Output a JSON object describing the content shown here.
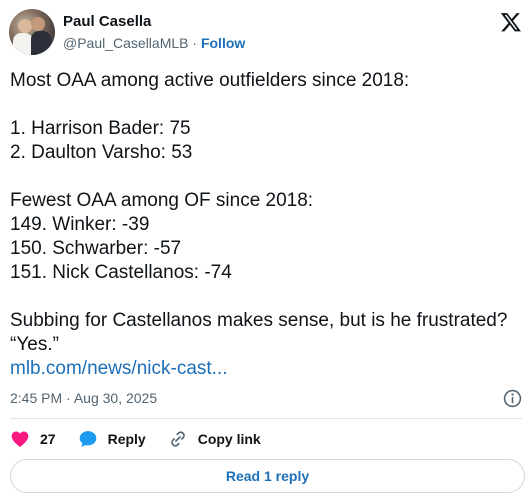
{
  "author": {
    "name": "Paul Casella",
    "handle": "@Paul_CasellaMLB",
    "separator": "·",
    "follow_label": "Follow",
    "avatar_icon": "profile-photo"
  },
  "tweet": {
    "lines": [
      "Most OAA among active outfielders since 2018:",
      "",
      "1. Harrison Bader: 75",
      "2. Daulton Varsho: 53",
      "",
      "Fewest OAA among OF since 2018:",
      "149. Winker: -39",
      "150. Schwarber: -57",
      "151. Nick Castellanos: -74",
      "",
      "Subbing for Castellanos makes sense, but is he frustrated?",
      "“Yes.”"
    ],
    "link": "mlb.com/news/nick-cast..."
  },
  "meta": {
    "time": "2:45 PM",
    "separator": "·",
    "date": "Aug 30, 2025"
  },
  "actions": {
    "like_count": "27",
    "reply_label": "Reply",
    "copy_link_label": "Copy link"
  },
  "read_replies_label": "Read 1 reply",
  "colors": {
    "like": "#f91880",
    "reply": "#1d9bf0",
    "link": "#1d6fb8",
    "muted": "#536471"
  },
  "icons": [
    "x-logo-icon",
    "info-icon",
    "heart-icon",
    "reply-bubble-icon",
    "link-icon"
  ]
}
